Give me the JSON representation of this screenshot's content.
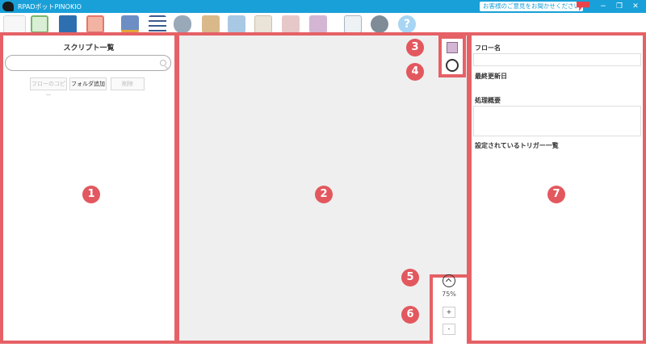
{
  "window": {
    "title": "RPADボットPINOKIO",
    "feedback_label": "お客様のご意見をお聞かせください",
    "minimize": "−",
    "restore": "❐",
    "close": "✕"
  },
  "toolbar": {
    "icons": [
      "new-flow-icon",
      "add-icon",
      "save-icon",
      "run-icon",
      "recorder-icon",
      "list-icon",
      "database-icon",
      "package-icon",
      "folder-icon",
      "mail-icon",
      "contact-icon",
      "download-icon",
      "note-icon",
      "gear-icon",
      "help-icon"
    ],
    "help_label": "?"
  },
  "left_panel": {
    "title": "スクリプト一覧",
    "search_placeholder": "",
    "buttons": {
      "copy_flow": "フローのコピー",
      "add_folder": "フォルダ追加",
      "delete": "削除"
    }
  },
  "zoom": {
    "level": "75%",
    "plus": "+",
    "minus": "-"
  },
  "right_panel": {
    "flow_name_label": "フロー名",
    "last_updated_label": "最終更新日",
    "summary_label": "処理概要",
    "triggers_label": "設定されているトリガー一覧"
  },
  "badges": [
    "1",
    "2",
    "3",
    "4",
    "5",
    "6",
    "7"
  ],
  "colors": {
    "titlebar": "#19a0d8",
    "highlight": "#e56166",
    "badge": "#e2585e",
    "canvas": "#efefef"
  }
}
